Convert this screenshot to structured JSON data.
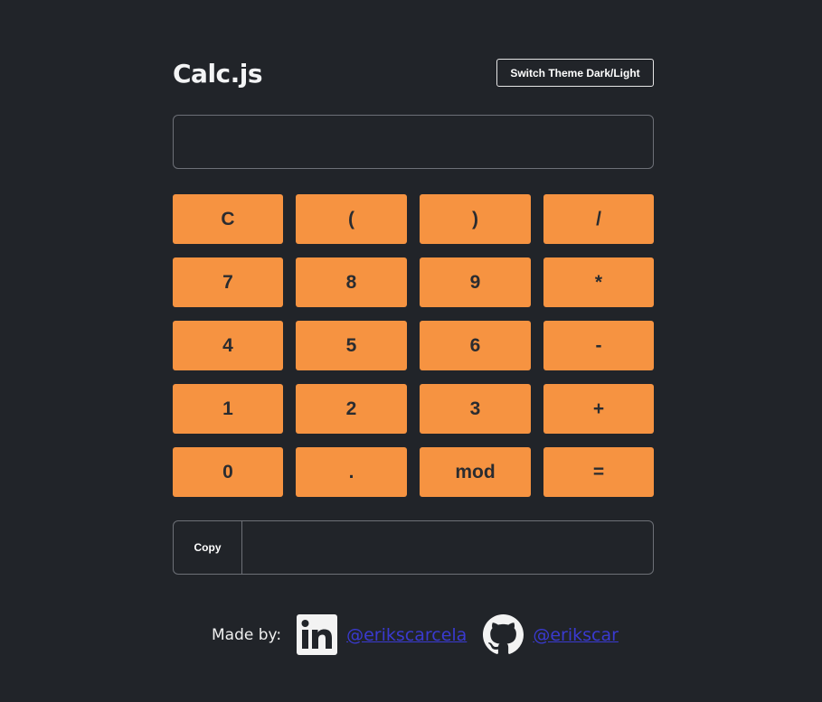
{
  "header": {
    "title": "Calc.js",
    "theme_button": "Switch Theme Dark/Light"
  },
  "display": {
    "value": "",
    "placeholder": ""
  },
  "keypad": {
    "keys": [
      "C",
      "(",
      ")",
      "/",
      "7",
      "8",
      "9",
      "*",
      "4",
      "5",
      "6",
      "-",
      "1",
      "2",
      "3",
      "+",
      "0",
      ".",
      "mod",
      "="
    ]
  },
  "result": {
    "copy_label": "Copy",
    "value": ""
  },
  "footer": {
    "made_by": "Made by:",
    "linkedin_handle": "@erikscarcela",
    "github_handle": "@erikscar",
    "linkedin_icon": "linkedin-icon",
    "github_icon": "github-icon"
  },
  "colors": {
    "background": "#212429",
    "key_fill": "#f69341",
    "key_text": "#2a2c30",
    "border": "#6d7077",
    "link": "#3a3ad0"
  }
}
